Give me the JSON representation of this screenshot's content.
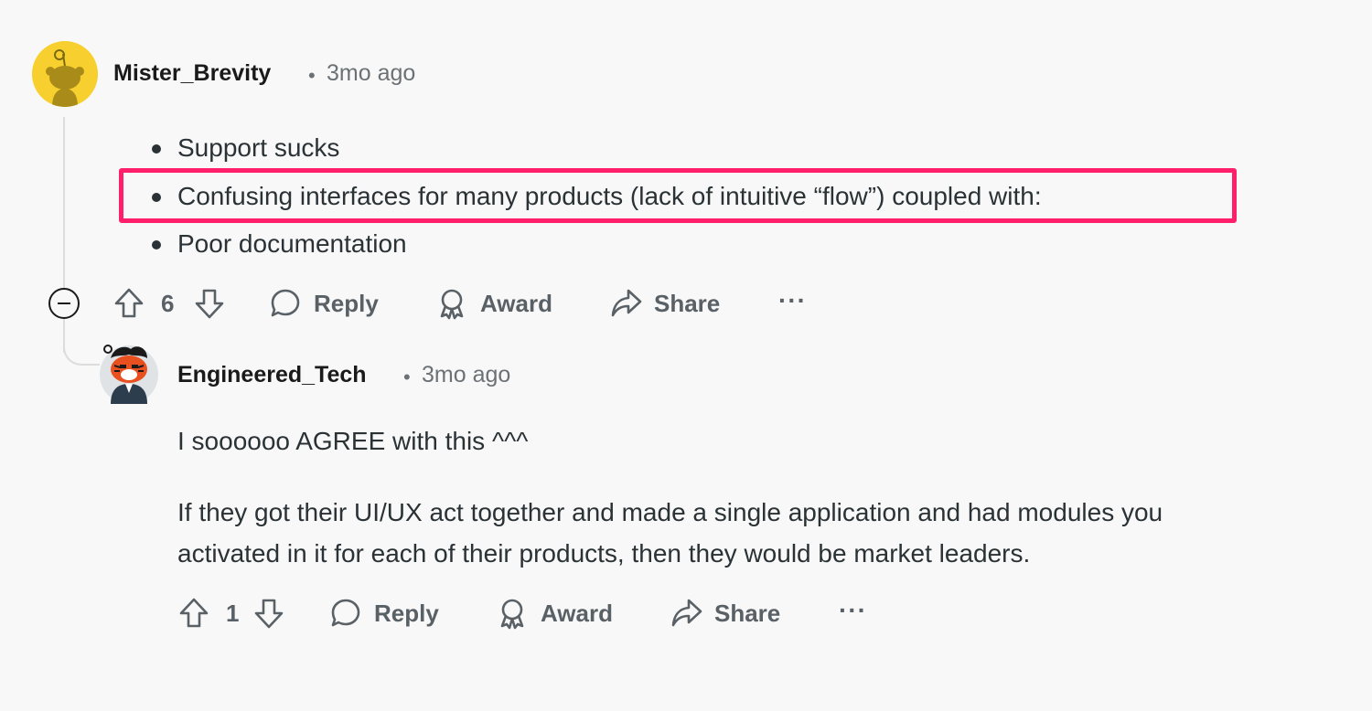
{
  "comment1": {
    "username": "Mister_Brevity",
    "separator": "•",
    "timestamp": "3mo ago",
    "bullets": [
      "Support sucks",
      "Confusing interfaces for many products (lack of intuitive “flow”) coupled with:",
      "Poor documentation"
    ],
    "votes": "6",
    "actions": {
      "reply": "Reply",
      "award": "Award",
      "share": "Share",
      "more": "···"
    }
  },
  "comment2": {
    "username": "Engineered_Tech",
    "separator": "•",
    "timestamp": "3mo ago",
    "paragraph1": "I soooooo AGREE with this ^^^",
    "paragraph2_line1": "If they got their UI/UX act together and made a single application and had modules you",
    "paragraph2_line2": "activated in it for each of their products, then they would be market leaders.",
    "votes": "1",
    "actions": {
      "reply": "Reply",
      "award": "Award",
      "share": "Share",
      "more": "···"
    }
  },
  "colors": {
    "background": "#f8f8f8",
    "highlight": "#ff1f6b",
    "avatar1": "#f7cf2e",
    "text_muted": "#5a6166"
  }
}
